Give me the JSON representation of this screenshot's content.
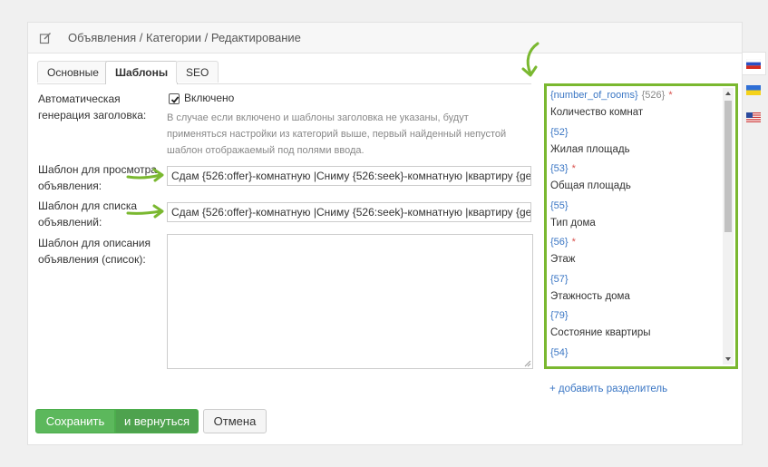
{
  "header": {
    "breadcrumb": "Объявления / Категории / Редактирование",
    "icon": "edit-icon"
  },
  "tabs": [
    {
      "label": "Основные",
      "active": false
    },
    {
      "label": "Шаблоны",
      "active": true
    },
    {
      "label": "SEO",
      "active": false
    }
  ],
  "auto_title": {
    "label_line1": "Автоматическая",
    "label_line2": "генерация заголовка:",
    "checkbox_label": "Включено",
    "checked": true,
    "hint_line1": "В случае если включено и шаблоны заголовка не указаны, будут",
    "hint_line2": "применяться настройки из категорий выше, первый найденный непустой",
    "hint_line3": "шаблон отображаемый под полями ввода."
  },
  "view_template": {
    "label_line1": "Шаблон для просмотра",
    "label_line2": "объявления:",
    "value": "Сдам {526:offer}-комнатную |Сниму {526:seek}-комнатную |квартиру {ge"
  },
  "list_template": {
    "label_line1": "Шаблон для списка",
    "label_line2": "объявлений:",
    "value": "Сдам {526:offer}-комнатную |Сниму {526:seek}-комнатную |квартиру {ge"
  },
  "desc_template": {
    "label_line1": "Шаблон для описания",
    "label_line2": "объявления (список):",
    "value": ""
  },
  "variables": [
    {
      "code": "{number_of_rooms}",
      "num": "{526}",
      "required": true,
      "name": "Количество комнат"
    },
    {
      "code": "{52}",
      "num": "",
      "required": false,
      "name": "Жилая площадь"
    },
    {
      "code": "{53}",
      "num": "",
      "required": true,
      "name": "Общая площадь"
    },
    {
      "code": "{55}",
      "num": "",
      "required": false,
      "name": "Тип дома"
    },
    {
      "code": "{56}",
      "num": "",
      "required": true,
      "name": "Этаж"
    },
    {
      "code": "{57}",
      "num": "",
      "required": false,
      "name": "Этажность дома"
    },
    {
      "code": "{79}",
      "num": "",
      "required": false,
      "name": "Состояние квартиры"
    },
    {
      "code": "{54}",
      "num": "",
      "required": false,
      "name": ""
    }
  ],
  "add_separator": "+ добавить разделитель",
  "buttons": {
    "save": "Сохранить",
    "save_return": "и вернуться",
    "cancel": "Отмена"
  },
  "languages": [
    "ru",
    "uk",
    "en"
  ],
  "colors": {
    "highlight": "#7ab830",
    "save": "#5cb85c",
    "link": "#3a76c4"
  }
}
